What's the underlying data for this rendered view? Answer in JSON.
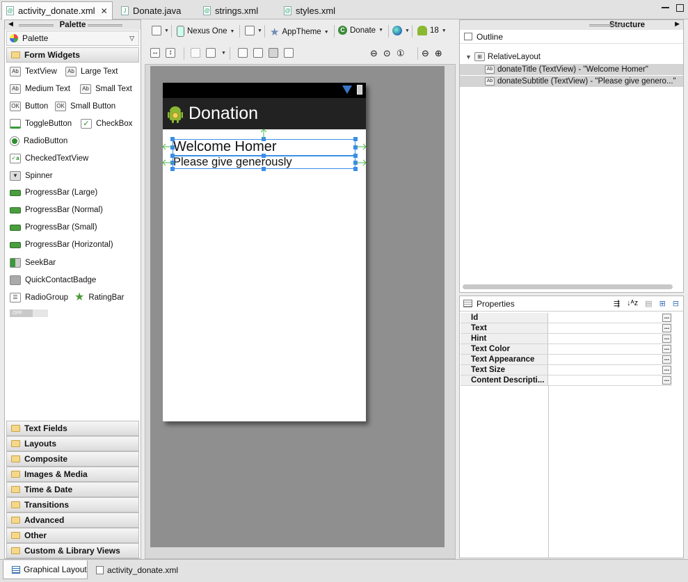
{
  "editor_tabs": [
    {
      "label": "activity_donate.xml",
      "active": true
    },
    {
      "label": "Donate.java",
      "active": false
    },
    {
      "label": "strings.xml",
      "active": false
    },
    {
      "label": "styles.xml",
      "active": false
    }
  ],
  "palette": {
    "header": "Palette",
    "selector": "Palette",
    "open_category": "Form Widgets",
    "widgets": {
      "textview": "TextView",
      "large_text": "Large Text",
      "medium_text": "Medium Text",
      "small_text": "Small Text",
      "button": "Button",
      "small_button": "Small Button",
      "togglebutton": "ToggleButton",
      "checkbox": "CheckBox",
      "radiobutton": "RadioButton",
      "checkedtextview": "CheckedTextView",
      "spinner": "Spinner",
      "progressbar_large": "ProgressBar (Large)",
      "progressbar_normal": "ProgressBar (Normal)",
      "progressbar_small": "ProgressBar (Small)",
      "progressbar_horizontal": "ProgressBar (Horizontal)",
      "seekbar": "SeekBar",
      "quickcontactbadge": "QuickContactBadge",
      "radiogroup": "RadioGroup",
      "ratingbar": "RatingBar",
      "switch_off": "OFF"
    },
    "categories": [
      "Text Fields",
      "Layouts",
      "Composite",
      "Images & Media",
      "Time & Date",
      "Transitions",
      "Advanced",
      "Other",
      "Custom & Library Views"
    ]
  },
  "canvas_toolbar": {
    "device": "Nexus One",
    "theme": "AppTheme",
    "activity": "Donate",
    "api_level": "18"
  },
  "device_preview": {
    "app_title": "Donation",
    "welcome_text": "Welcome Homer",
    "subtitle_text": "Please give generously"
  },
  "structure": {
    "header": "Structure",
    "outline_label": "Outline",
    "root": "RelativeLayout",
    "children": [
      "donateTitle (TextView) - \"Welcome Homer\"",
      "donateSubtitle (TextView) - \"Please give genero...\""
    ]
  },
  "properties": {
    "header": "Properties",
    "rows": [
      "Id",
      "Text",
      "Hint",
      "Text Color",
      "Text Appearance",
      "Text Size",
      "Content Descripti..."
    ],
    "dots": "..."
  },
  "bottom_tabs": [
    "Graphical Layout",
    "activity_donate.xml"
  ]
}
